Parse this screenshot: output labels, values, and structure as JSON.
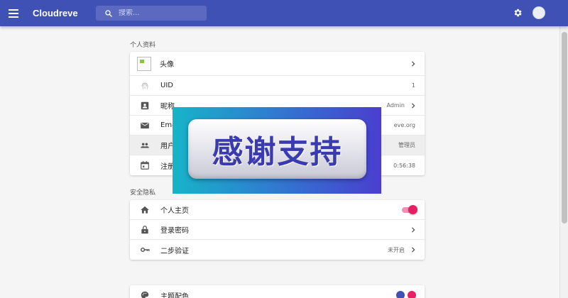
{
  "appbar": {
    "title": "Cloudreve",
    "search_placeholder": "搜索...",
    "settings_icon": "gear-icon",
    "menu_icon": "menu-icon",
    "bg_color": "#3f51b5"
  },
  "profile": {
    "section_title": "个人资料",
    "avatar_label": "头像",
    "uid_label": "UID",
    "uid_value": "1",
    "nickname_label": "昵称",
    "nickname_value": "Admin",
    "email_label": "Ema",
    "email_value": "eve.org",
    "group_label": "用户",
    "group_value": "管理员",
    "register_label": "注册",
    "register_value": "0:56:38"
  },
  "security": {
    "section_title": "安全隐私",
    "homepage_label": "个人主页",
    "homepage_enabled": true,
    "password_label": "登录密码",
    "twofa_label": "二步验证",
    "twofa_value": "未开启"
  },
  "theme": {
    "label": "主题配色",
    "colors": [
      "#3f51b5",
      "#e91e63"
    ]
  },
  "overlay": {
    "text": "感谢支持"
  }
}
